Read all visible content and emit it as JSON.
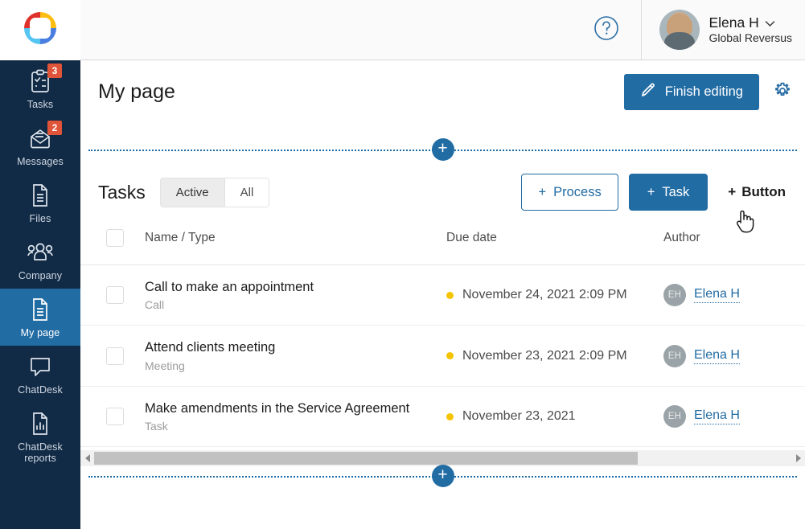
{
  "sidebar": {
    "logo_icon": "company-logo-ring",
    "items": [
      {
        "label": "Tasks",
        "icon": "clipboard-check-icon",
        "badge": "3",
        "active": false
      },
      {
        "label": "Messages",
        "icon": "envelope-icon",
        "badge": "2",
        "active": false
      },
      {
        "label": "Files",
        "icon": "document-icon",
        "badge": null,
        "active": false
      },
      {
        "label": "Company",
        "icon": "people-group-icon",
        "badge": null,
        "active": false
      },
      {
        "label": "My page",
        "icon": "document-icon",
        "badge": null,
        "active": true
      },
      {
        "label": "ChatDesk",
        "icon": "chat-bubble-icon",
        "badge": null,
        "active": false
      },
      {
        "label": "ChatDesk reports",
        "icon": "bar-chart-doc-icon",
        "badge": null,
        "active": false
      }
    ]
  },
  "topbar": {
    "help_icon": "question-mark-circle-icon",
    "user": {
      "name": "Elena H",
      "org": "Global Reversus",
      "chevron_icon": "chevron-down-icon",
      "avatar_icon": "user-photo-avatar"
    }
  },
  "page": {
    "title": "My page",
    "finish_button": {
      "label": "Finish editing",
      "icon": "pencil-icon"
    },
    "settings_icon": "gear-icon",
    "add_section_top": {
      "icon": "plus-icon",
      "label": "+"
    },
    "add_section_bottom": {
      "icon": "plus-icon",
      "label": "+"
    }
  },
  "widget": {
    "title": "Tasks",
    "filters": [
      {
        "label": "Active",
        "selected": true
      },
      {
        "label": "All",
        "selected": false
      }
    ],
    "actions": {
      "process": {
        "label": "Process",
        "plus": "+"
      },
      "task": {
        "label": "Task",
        "plus": "+"
      },
      "add_button": {
        "label": "Button",
        "plus": "+"
      }
    },
    "table": {
      "columns": [
        "",
        "Name / Type",
        "Due date",
        "Author"
      ],
      "rows": [
        {
          "name": "Call to make an appointment",
          "type": "Call",
          "due": "November 24, 2021 2:09 PM",
          "status_color": "#f5c400",
          "author": "Elena H",
          "author_initials": "EH",
          "checked": false
        },
        {
          "name": "Attend clients meeting",
          "type": "Meeting",
          "due": "November 23, 2021 2:09 PM",
          "status_color": "#f5c400",
          "author": "Elena H",
          "author_initials": "EH",
          "checked": false
        },
        {
          "name": "Make amendments in the Service Agreement",
          "type": "Task",
          "due": "November 23, 2021",
          "status_color": "#f5c400",
          "author": "Elena H",
          "author_initials": "EH",
          "checked": false
        }
      ]
    },
    "scrollbar": {
      "left_icon": "arrow-left-icon",
      "right_icon": "arrow-right-icon"
    }
  },
  "colors": {
    "sidebar_bg": "#112a45",
    "accent_blue": "#226ca4",
    "badge_red": "#e0543a",
    "status_yellow": "#f5c400",
    "active_nav": "#226ca4"
  },
  "cursor": {
    "icon": "pointing-hand-cursor"
  }
}
